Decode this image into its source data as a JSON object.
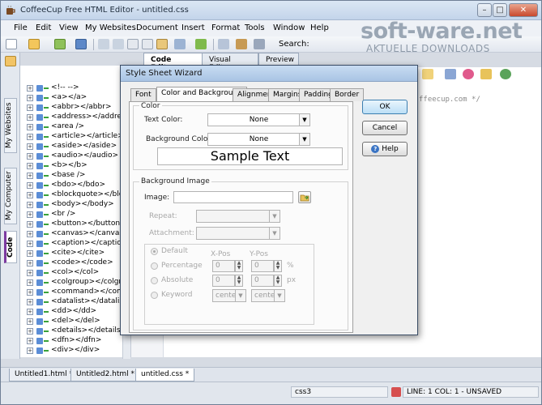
{
  "app": {
    "title": "CoffeeCup Free HTML Editor - untitled.css"
  },
  "menubar": {
    "items": [
      "File",
      "Edit",
      "View",
      "My Websites",
      "Document",
      "Insert",
      "Format",
      "Tools",
      "Window",
      "Help"
    ]
  },
  "toolbar": {
    "search_label": "Search:"
  },
  "watermark": {
    "logo": "soft-ware.net",
    "tagline": "AKTUELLE DOWNLOADS"
  },
  "left_panel": {
    "tabs": [
      "My Websites",
      "My Computer",
      "Code"
    ],
    "tree_items": [
      "<!-- -->",
      "<a></a>",
      "<abbr></abbr>",
      "<address></address>",
      "<area />",
      "<article></article>",
      "<aside></aside>",
      "<audio></audio>",
      "<b></b>",
      "<base />",
      "<bdo></bdo>",
      "<blockquote></blockquo",
      "<body></body>",
      "<br />",
      "<button></button>",
      "<canvas></canvas>",
      "<caption></caption>",
      "<cite></cite>",
      "<code></code>",
      "<col></col>",
      "<colgroup></colgroup>",
      "<command></command>",
      "<datalist></datalist>",
      "<dd></dd>",
      "<del></del>",
      "<details></details>",
      "<dfn></dfn>",
      "<div></div>"
    ]
  },
  "editor": {
    "tabs": [
      "Code Editor",
      "Visual Editor",
      "Preview"
    ],
    "code_fragment": "ffeecup.com */"
  },
  "doc_tabs": [
    "Untitled1.html *",
    "Untitled2.html *",
    "untitled.css *"
  ],
  "status": {
    "syntax": "css3",
    "position": "LINE: 1  COL: 1 - UNSAVED"
  },
  "dialog": {
    "title": "Style Sheet Wizard",
    "tabs": [
      "Font",
      "Color and Background",
      "Alignment",
      "Margins",
      "Padding",
      "Border"
    ],
    "buttons": {
      "ok": "OK",
      "cancel": "Cancel",
      "help": "Help"
    },
    "color_group": {
      "label": "Color",
      "text_color_label": "Text Color:",
      "text_color_value": "None",
      "bg_color_label": "Background Color:",
      "bg_color_value": "None",
      "sample": "Sample Text"
    },
    "bg_image_group": {
      "label": "Background Image",
      "image_label": "Image:",
      "image_value": "",
      "repeat_label": "Repeat:",
      "attachment_label": "Attachment:",
      "xpos_label": "X-Pos",
      "ypos_label": "Y-Pos",
      "options": [
        "Default",
        "Percentage",
        "Absolute",
        "Keyword"
      ],
      "percentage_x": "0",
      "percentage_y": "0",
      "percentage_unit": "%",
      "absolute_x": "0",
      "absolute_y": "0",
      "absolute_unit": "px",
      "keyword_x": "center",
      "keyword_y": "center"
    }
  }
}
